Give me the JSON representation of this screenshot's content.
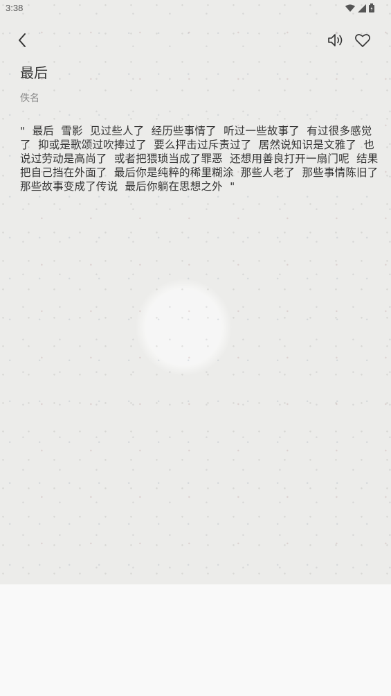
{
  "status_bar": {
    "time": "3:38",
    "icons": [
      "wifi-icon",
      "signal-icon",
      "battery-icon"
    ]
  },
  "nav": {
    "back_icon": "chevron-left-icon",
    "speaker_icon": "speaker-icon",
    "favorite_icon": "heart-icon"
  },
  "poem": {
    "title": "最后",
    "author": "佚名",
    "body": "\"  最后  雪影  见过些人了  经历些事情了  听过一些故事了  有过很多感觉了  抑或是歌颂过吹捧过了  要么抨击过斥责过了  居然说知识是文雅了  也说过劳动是高尚了  或者把猥琐当成了罪恶  还想用善良打开一扇门呢  结果把自己挡在外面了  最后你是纯粹的稀里糊涂  那些人老了  那些事情陈旧了  那些故事变成了传说  最后你躺在思想之外  \""
  },
  "colors": {
    "paper": "#ececea",
    "below_paper": "#f9f9f9",
    "text": "#333333",
    "author": "#888888"
  }
}
